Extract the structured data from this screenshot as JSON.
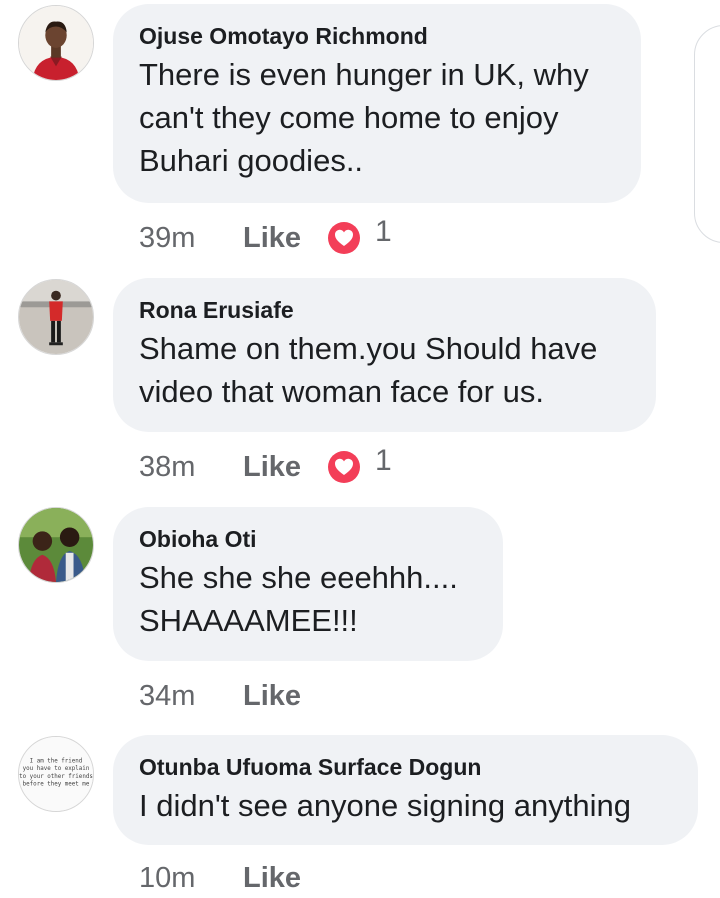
{
  "comments": [
    {
      "author": "Ojuse Omotayo Richmond",
      "text": "There is even hunger in UK, why can't they come home to enjoy Buhari goodies..",
      "time": "39m",
      "like_label": "Like",
      "reaction_icon": "heart-reaction-icon",
      "reaction_count": "1"
    },
    {
      "author": "Rona Erusiafe",
      "text": "Shame on them.you Should have video that woman  face for us.",
      "time": "38m",
      "like_label": "Like",
      "reaction_icon": "heart-reaction-icon",
      "reaction_count": "1"
    },
    {
      "author": "Obioha Oti",
      "text": "She she she eeehhh.... SHAAAAMEE!!!",
      "time": "34m",
      "like_label": "Like"
    },
    {
      "author": "Otunba Ufuoma Surface Dogun",
      "text": "I didn't see anyone signing anything",
      "time": "10m",
      "like_label": "Like"
    }
  ],
  "avatar_texts": {
    "otunba": [
      "I am the friend",
      "you have to explain",
      "to your other friends",
      "before they meet me"
    ]
  },
  "colors": {
    "bubble_bg": "#f0f2f5",
    "name_text": "#1c1e21",
    "meta_text": "#65676b",
    "heart_red": "#f33e58"
  }
}
